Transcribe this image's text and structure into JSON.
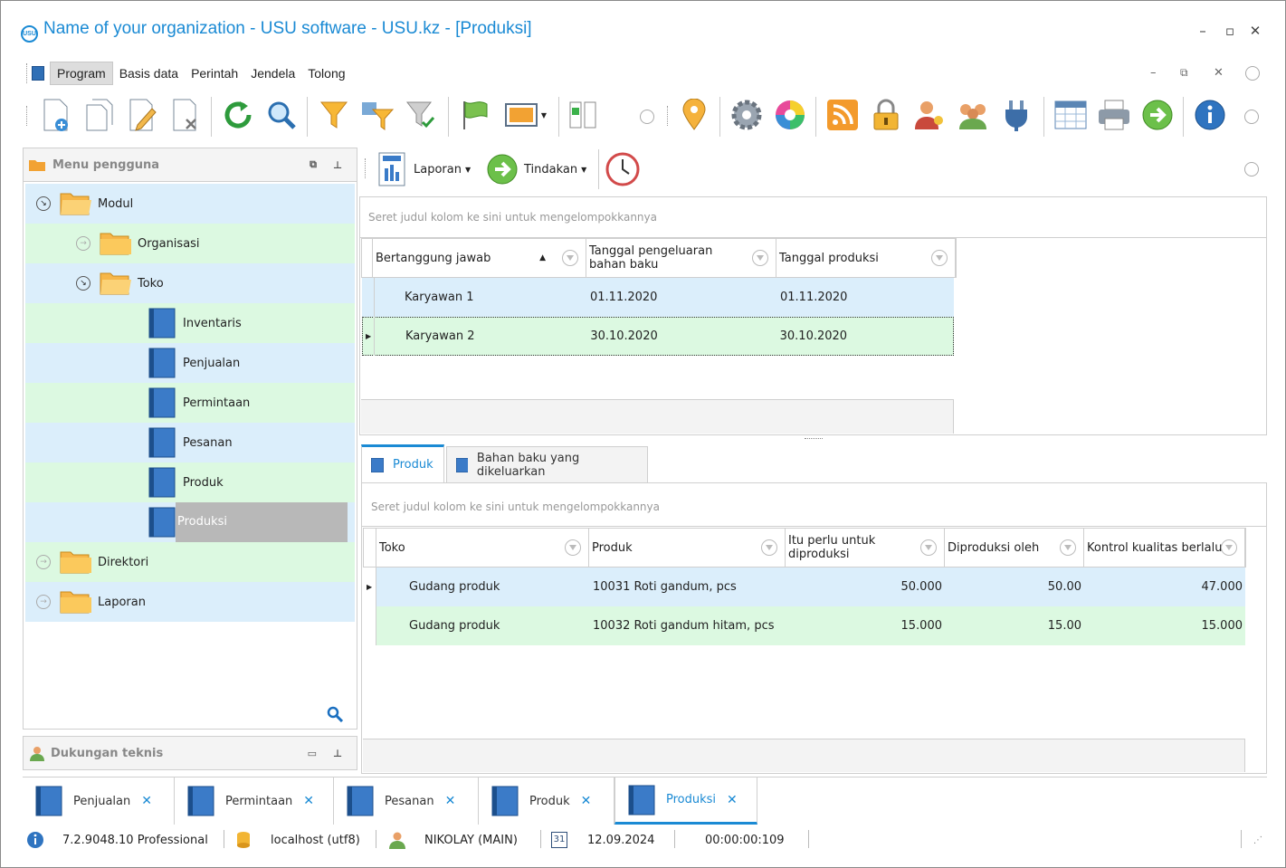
{
  "window": {
    "title": "Name of your organization - USU software - USU.kz - [Produksi]",
    "logo_text": "USU"
  },
  "menubar": {
    "items": [
      "Program",
      "Basis data",
      "Perintah",
      "Jendela",
      "Tolong"
    ]
  },
  "user_menu": {
    "title": "Menu pengguna"
  },
  "tree": {
    "modul": "Modul",
    "organisasi": "Organisasi",
    "toko": "Toko",
    "items": [
      "Inventaris",
      "Penjualan",
      "Permintaan",
      "Pesanan",
      "Produk",
      "Produksi"
    ],
    "direktori": "Direktori",
    "laporan": "Laporan"
  },
  "support": {
    "title": "Dukungan teknis"
  },
  "subtoolbar": {
    "laporan": "Laporan",
    "tindakan": "Tindakan"
  },
  "top_grid": {
    "group_hint": "Seret judul kolom ke sini untuk mengelompokkannya",
    "columns": [
      "Bertanggung jawab",
      "Tanggal pengeluaran bahan baku",
      "Tanggal produksi"
    ],
    "rows": [
      [
        "Karyawan 1",
        "01.11.2020",
        "01.11.2020"
      ],
      [
        "Karyawan 2",
        "30.10.2020",
        "30.10.2020"
      ]
    ]
  },
  "detail_tabs": [
    "Produk",
    "Bahan baku yang dikeluarkan"
  ],
  "bottom_grid": {
    "group_hint": "Seret judul kolom ke sini untuk mengelompokkannya",
    "columns": [
      "Toko",
      "Produk",
      "Itu perlu untuk diproduksi",
      "Diproduksi oleh",
      "Kontrol kualitas berlalu"
    ],
    "rows": [
      [
        "Gudang produk",
        "10031 Roti gandum, pcs",
        "50.000",
        "50.00",
        "47.000"
      ],
      [
        "Gudang produk",
        "10032 Roti gandum hitam, pcs",
        "15.000",
        "15.00",
        "15.000"
      ]
    ]
  },
  "bottom_tabs": [
    "Penjualan",
    "Permintaan",
    "Pesanan",
    "Produk",
    "Produksi"
  ],
  "status": {
    "version": "7.2.9048.10 Professional",
    "db": "localhost (utf8)",
    "user": "NIKOLAY (MAIN)",
    "calendar_day": "31",
    "date": "12.09.2024",
    "timer": "00:00:00:109"
  },
  "colors": {
    "accent": "#1a8ad4",
    "row_blue": "#dbeefb",
    "row_green": "#dcf9e1",
    "selected": "#b8b8b8"
  }
}
